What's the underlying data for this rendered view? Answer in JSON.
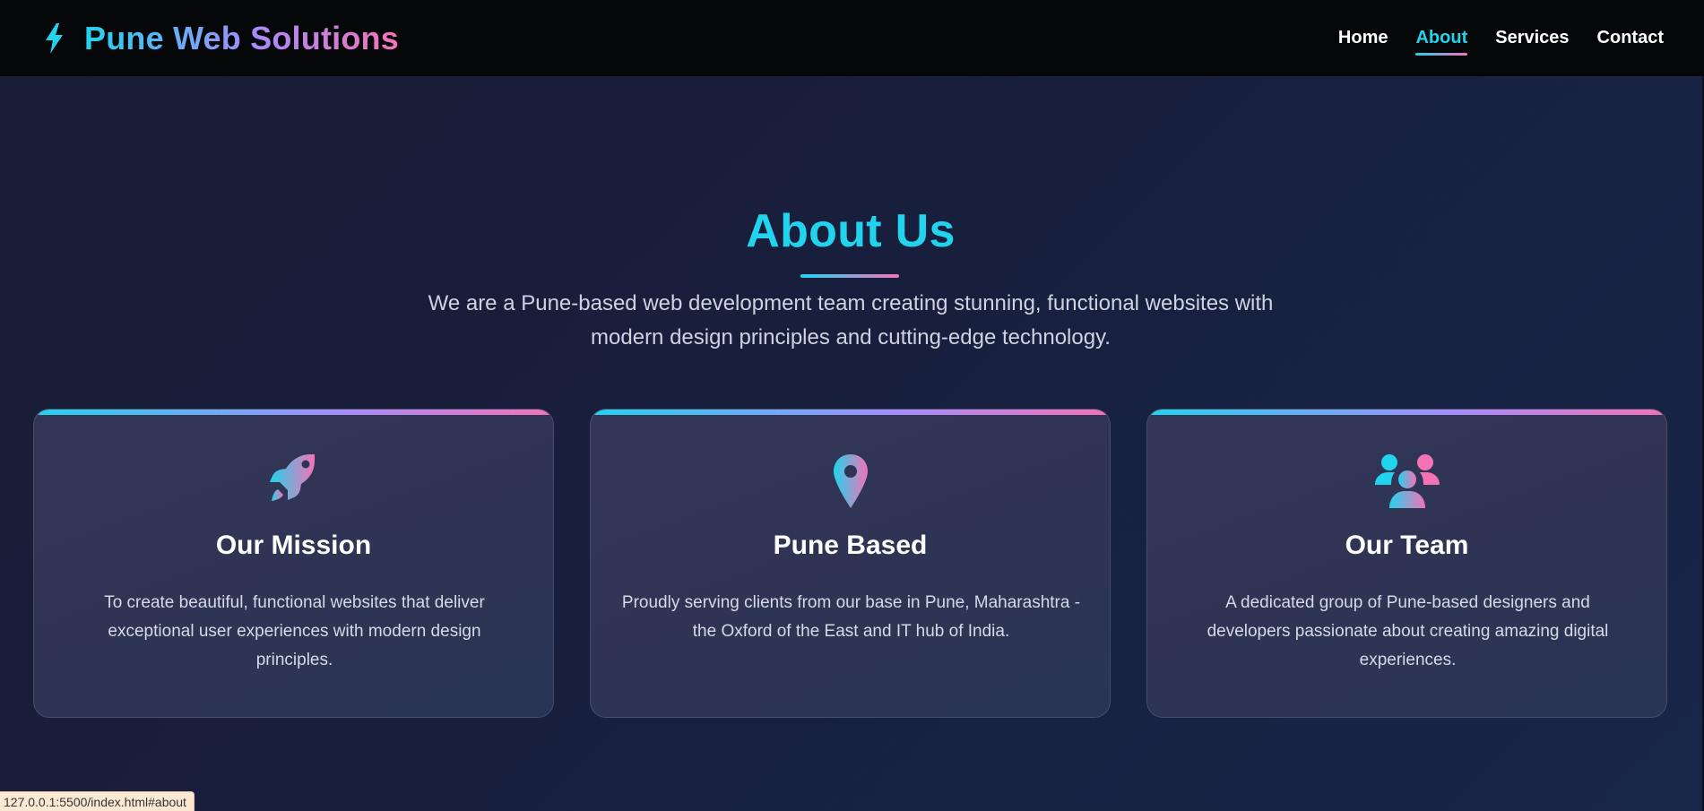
{
  "brand": {
    "name": "Pune Web Solutions",
    "icon": "lightning-bolt-icon"
  },
  "nav": {
    "items": [
      {
        "label": "Home",
        "active": false
      },
      {
        "label": "About",
        "active": true
      },
      {
        "label": "Services",
        "active": false
      },
      {
        "label": "Contact",
        "active": false
      }
    ]
  },
  "about": {
    "title": "About Us",
    "subtitle": "We are a Pune-based web development team creating stunning, functional websites with modern design principles and cutting-edge technology.",
    "cards": [
      {
        "icon": "rocket-icon",
        "title": "Our Mission",
        "text": "To create beautiful, functional websites that deliver exceptional user experiences with modern design principles."
      },
      {
        "icon": "map-pin-icon",
        "title": "Pune Based",
        "text": "Proudly serving clients from our base in Pune, Maharashtra - the Oxford of the East and IT hub of India."
      },
      {
        "icon": "team-icon",
        "title": "Our Team",
        "text": "A dedicated group of Pune-based designers and developers passionate about creating amazing digital experiences."
      }
    ]
  },
  "status_bar": {
    "url": "127.0.0.1:5500/index.html#about"
  },
  "colors": {
    "accent_cyan": "#22d3ee",
    "accent_pink": "#f472b6",
    "accent_violet": "#a78bfa",
    "nav_bg": "#040608"
  }
}
